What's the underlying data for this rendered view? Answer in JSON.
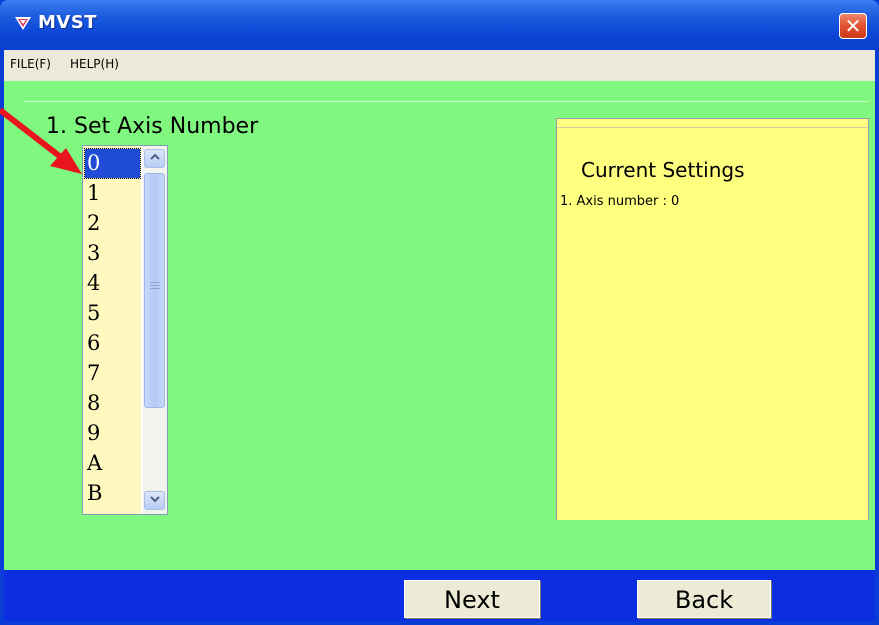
{
  "window": {
    "title": "MVST",
    "close_label": "✕"
  },
  "menu": {
    "items": [
      {
        "label": "FILE(F)"
      },
      {
        "label": "HELP(H)"
      }
    ]
  },
  "main": {
    "section_title": "1. Set Axis Number",
    "axis_list": {
      "items": [
        "0",
        "1",
        "2",
        "3",
        "4",
        "5",
        "6",
        "7",
        "8",
        "9",
        "A",
        "B"
      ],
      "selected": "0"
    }
  },
  "settings": {
    "title": "Current Settings",
    "lines": [
      "1. Axis number : 0"
    ]
  },
  "footer": {
    "next_label": "Next",
    "back_label": "Back"
  },
  "colors": {
    "client_bg": "#80f880",
    "settings_bg": "#ffff80",
    "footer_bg": "#0a2ee0",
    "arrow": "#e8141e"
  }
}
